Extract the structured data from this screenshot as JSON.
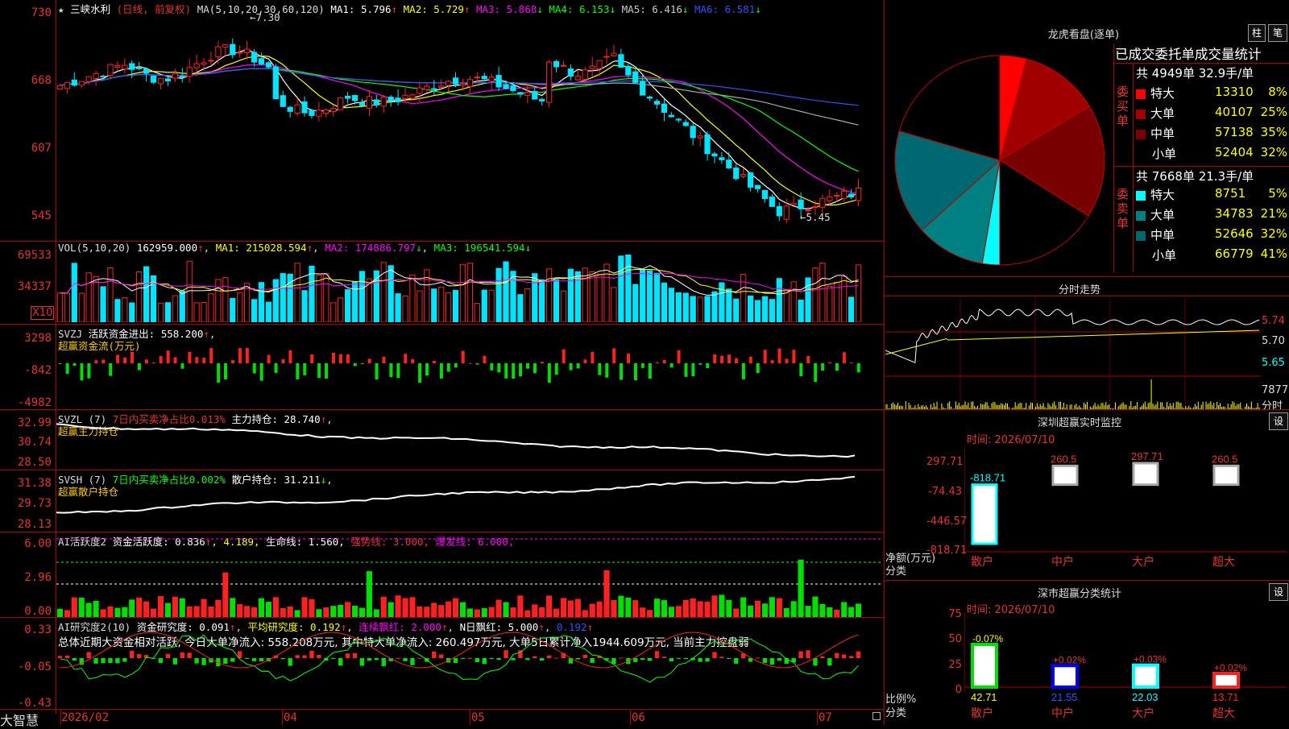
{
  "app": {
    "brand": "大智慧"
  },
  "kline": {
    "header": {
      "star": "★",
      "name": "三峡水利",
      "mode": "(日线, 前复权)",
      "ma_label": "MA(5,10,20,30,60,120)",
      "ma1": "MA1: 5.796",
      "ma2": "MA2: 5.729",
      "ma3": "MA3: 5.868",
      "ma4": "MA4: 6.153",
      "ma5": "MA5: 6.416",
      "ma6": "MA6: 6.581"
    },
    "yticks": [
      "730",
      "668",
      "607",
      "545"
    ],
    "high_mark": "7.30",
    "low_mark": "5.45",
    "colors": {
      "up": "#ff2020",
      "down": "#00e5ff",
      "ma1": "#ffffff",
      "ma2": "#ffff00",
      "ma3": "#ff00ff",
      "ma4": "#00ff00",
      "ma5": "#aaaaaa",
      "ma6": "#3050ff"
    }
  },
  "vol": {
    "header": "VOL(5,10,20)",
    "v": "162959.000",
    "ma1": "MA1: 215028.594",
    "ma2": "MA2: 174886.797",
    "ma3": "MA3: 196541.594",
    "yticks": [
      "69533",
      "34337"
    ],
    "unit": "X10"
  },
  "svzj": {
    "header": "SVZJ",
    "label": "活跃资金进出: 558.200",
    "sub": "超赢资金流(万元)",
    "yticks": [
      "3298",
      "-842",
      "-4982"
    ]
  },
  "svzl": {
    "header": "SVZL (7)",
    "label1": "7日内买卖净占比0.013%",
    "label2": "主力持仓: 28.740",
    "sub": "超赢主力持仓",
    "yticks": [
      "32.99",
      "30.74",
      "28.50"
    ]
  },
  "svsh": {
    "header": "SVSH (7)",
    "label1": "7日内买卖净占比0.002%",
    "label2": "散户持仓: 31.211",
    "sub": "超赢散户持仓",
    "yticks": [
      "31.38",
      "29.73",
      "28.13"
    ]
  },
  "ai1": {
    "header": "AI活跃度2",
    "l1": "资金活跃度: 0.836",
    "l2": "4.189,",
    "l3": "生命线: 1.560,",
    "l4": "强势线: 3.000,",
    "l5": "爆发线: 6.000,",
    "yticks": [
      "6.00",
      "2.96",
      "0.00"
    ]
  },
  "ai2": {
    "header": "AI研究度2(10)",
    "l1": "资金研究度: 0.091",
    "l2": "平均研究度: 0.192",
    "l3": "连续飘红: 2.000",
    "l4": "N日飘红: 5.000",
    "l5": "0.192",
    "note": "总体近期大资金相对活跃, 今日大单净流入: 558.208万元, 其中特大单净流入: 260.497万元, 大单5日累计净入1944.609万元, 当前主力控盘弱",
    "yticks": [
      "0.33",
      "-0.05",
      "-0.43"
    ]
  },
  "xaxis": [
    "2026/02",
    "04",
    "05",
    "06",
    "07"
  ],
  "dragon": {
    "title": "龙虎看盘(逐单)",
    "btn1": "柱",
    "btn2": "笔",
    "table_title": "已成交委托单成交量统计",
    "buy": {
      "label": "委买单",
      "total": "共 4949单 32.9手/单",
      "rows": [
        {
          "name": "特大",
          "vol": "13310",
          "pct": "8%",
          "color": "#ff0000"
        },
        {
          "name": "大单",
          "vol": "40107",
          "pct": "25%",
          "color": "#a00000"
        },
        {
          "name": "中单",
          "vol": "57138",
          "pct": "35%",
          "color": "#780000"
        },
        {
          "name": "小单",
          "vol": "52404",
          "pct": "32%",
          "color": "#000000"
        }
      ]
    },
    "sell": {
      "label": "委卖单",
      "total": "共 7668单 21.3手/单",
      "rows": [
        {
          "name": "特大",
          "vol": "8751",
          "pct": "5%",
          "color": "#00ffff"
        },
        {
          "name": "大单",
          "vol": "34783",
          "pct": "21%",
          "color": "#008080"
        },
        {
          "name": "中单",
          "vol": "52646",
          "pct": "32%",
          "color": "#006870"
        },
        {
          "name": "小单",
          "vol": "66779",
          "pct": "41%",
          "color": "#000000"
        }
      ]
    }
  },
  "intraday": {
    "title": "分时走势",
    "yticks": [
      "5.74",
      "5.70",
      "5.65"
    ],
    "vol_label": "7877",
    "vol_unit": "分时"
  },
  "sz_monitor": {
    "title": "深圳超赢实时监控",
    "btn": "设",
    "time": "时间: 2026/07/10",
    "yticks": [
      "297.71",
      "-74.43",
      "-446.57",
      "-818.71"
    ],
    "ylabel": "净额(万元)",
    "xlabel": "分类",
    "cats": [
      "散户",
      "中户",
      "大户",
      "超大"
    ],
    "values": [
      "-818.71",
      "260.5",
      "297.71",
      "260.5"
    ]
  },
  "sz_class": {
    "title": "深市超赢分类统计",
    "btn": "设",
    "time": "时间: 2026/07/10",
    "yticks": [
      "75",
      "50",
      "25",
      "0"
    ],
    "ylabel": "比例%",
    "xlabel": "分类",
    "cats": [
      "散户",
      "中户",
      "大户",
      "超大"
    ],
    "values": [
      "42.71",
      "21.55",
      "22.03",
      "13.71"
    ],
    "changes": [
      "-0.07%",
      "+0.02%",
      "+0.03%",
      "+0.02%"
    ]
  }
}
